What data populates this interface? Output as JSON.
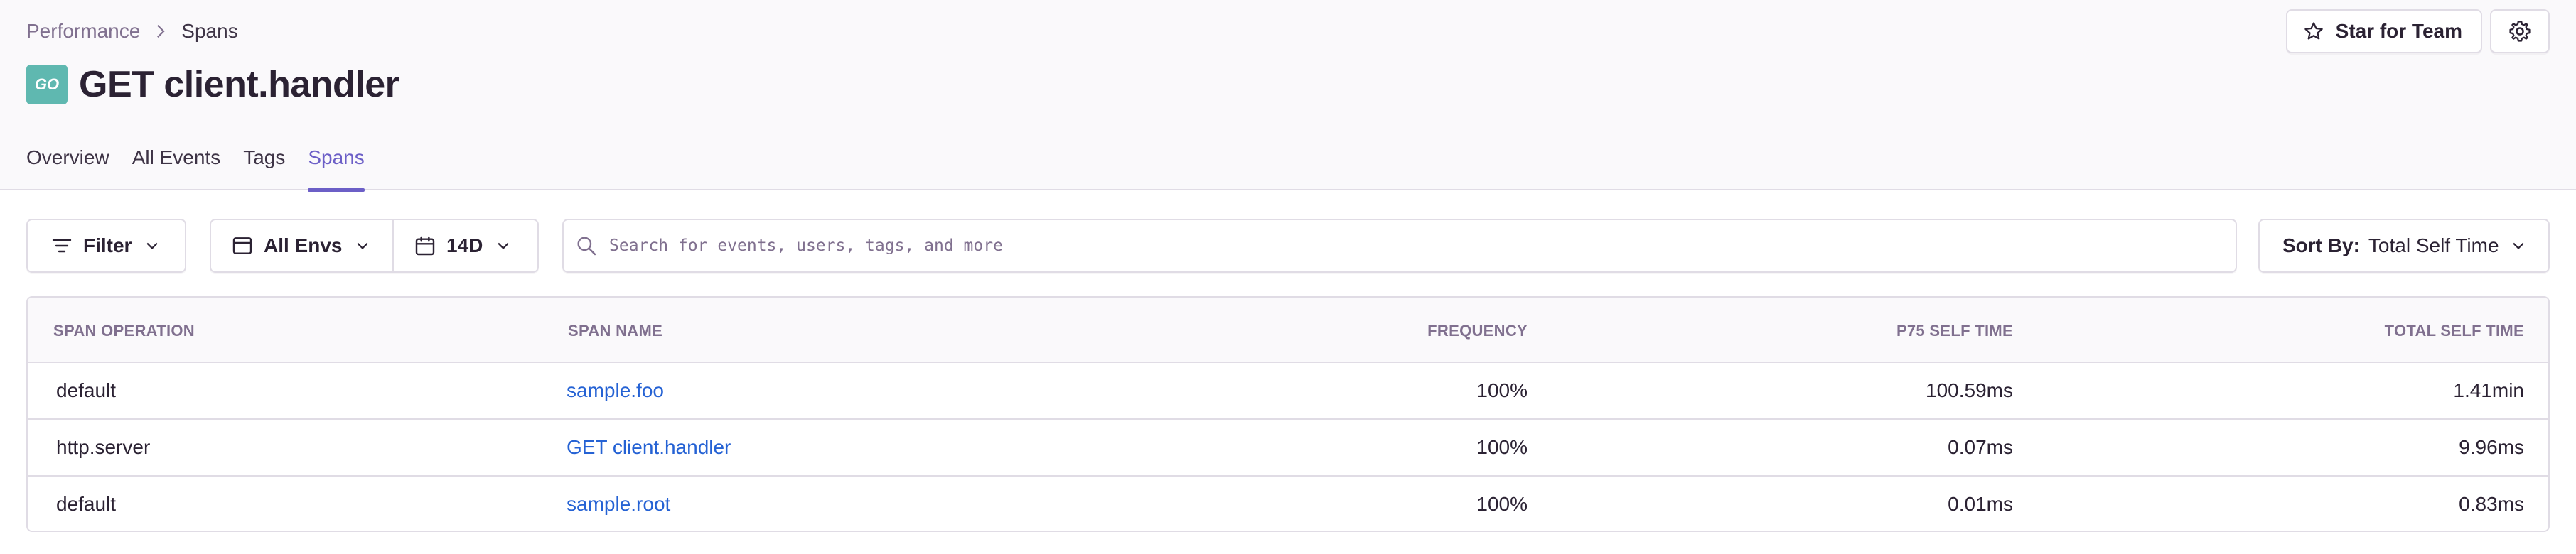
{
  "breadcrumb": {
    "parent": "Performance",
    "current": "Spans"
  },
  "title": {
    "platform_badge": "GO",
    "text": "GET client.handler"
  },
  "actions": {
    "star_label": "Star for Team"
  },
  "tabs": [
    {
      "label": "Overview",
      "active": false
    },
    {
      "label": "All Events",
      "active": false
    },
    {
      "label": "Tags",
      "active": false
    },
    {
      "label": "Spans",
      "active": true
    }
  ],
  "controls": {
    "filter_label": "Filter",
    "env_label": "All Envs",
    "date_label": "14D",
    "search_placeholder": "Search for events, users, tags, and more",
    "sort_prefix": "Sort By:",
    "sort_value": "Total Self Time"
  },
  "table": {
    "columns": [
      "SPAN OPERATION",
      "SPAN NAME",
      "FREQUENCY",
      "P75 SELF TIME",
      "TOTAL SELF TIME"
    ],
    "rows": [
      {
        "operation": "default",
        "name": "sample.foo",
        "frequency": "100%",
        "p75": "100.59ms",
        "total": "1.41min"
      },
      {
        "operation": "http.server",
        "name": "GET client.handler",
        "frequency": "100%",
        "p75": "0.07ms",
        "total": "9.96ms"
      },
      {
        "operation": "default",
        "name": "sample.root",
        "frequency": "100%",
        "p75": "0.01ms",
        "total": "0.83ms"
      }
    ]
  },
  "colors": {
    "accent": "#6c5fc7",
    "link": "#2562d4",
    "go_badge": "#5fb8b0",
    "muted": "#80708f",
    "border": "#e0dce5"
  }
}
